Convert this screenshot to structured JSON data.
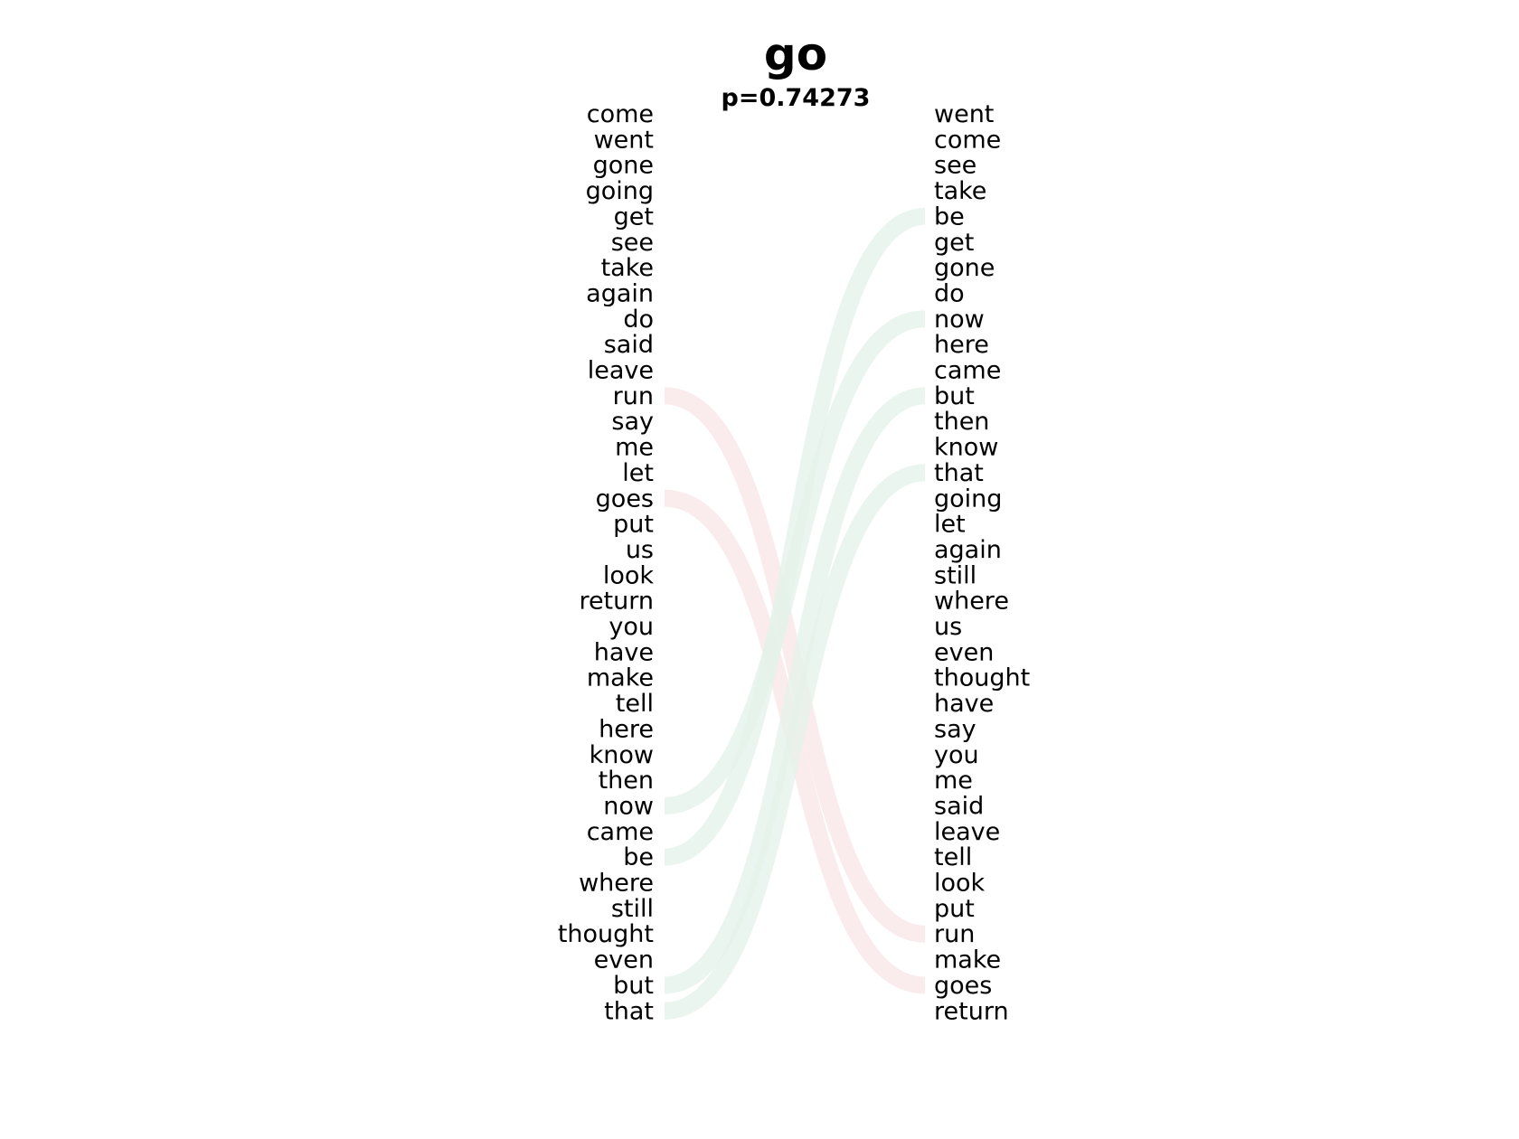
{
  "title": "go",
  "subtitle": "p=0.74273",
  "left_words": [
    "come",
    "went",
    "gone",
    "going",
    "get",
    "see",
    "take",
    "again",
    "do",
    "said",
    "leave",
    "run",
    "say",
    "me",
    "let",
    "goes",
    "put",
    "us",
    "look",
    "return",
    "you",
    "have",
    "make",
    "tell",
    "here",
    "know",
    "then",
    "now",
    "came",
    "be",
    "where",
    "still",
    "thought",
    "even",
    "but",
    "that"
  ],
  "right_words": [
    "went",
    "come",
    "see",
    "take",
    "be",
    "get",
    "gone",
    "do",
    "now",
    "here",
    "came",
    "but",
    "then",
    "know",
    "that",
    "going",
    "let",
    "again",
    "still",
    "where",
    "us",
    "even",
    "thought",
    "have",
    "say",
    "you",
    "me",
    "said",
    "leave",
    "tell",
    "look",
    "put",
    "run",
    "make",
    "goes",
    "return"
  ],
  "links": [
    {
      "left": "run",
      "right": "run",
      "color": "#f8e4e6",
      "opacity": 0.75
    },
    {
      "left": "goes",
      "right": "goes",
      "color": "#f8e4e6",
      "opacity": 0.75
    },
    {
      "left": "now",
      "right": "now",
      "color": "#e4f1ea",
      "opacity": 0.75
    },
    {
      "left": "be",
      "right": "be",
      "color": "#e4f1ea",
      "opacity": 0.75
    },
    {
      "left": "but",
      "right": "but",
      "color": "#e4f1ea",
      "opacity": 0.75
    },
    {
      "left": "that",
      "right": "that",
      "color": "#e4f1ea",
      "opacity": 0.75
    }
  ]
}
